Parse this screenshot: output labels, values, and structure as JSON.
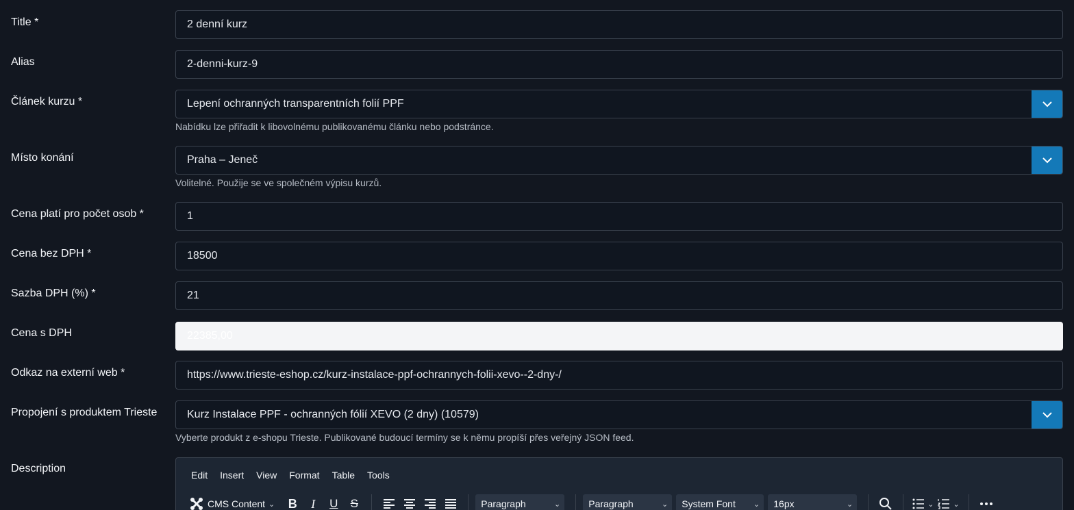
{
  "fields": {
    "title": {
      "label": "Title *",
      "value": "2 denní kurz"
    },
    "alias": {
      "label": "Alias",
      "value": "2-denni-kurz-9"
    },
    "clanek": {
      "label": "Článek kurzu *",
      "value": "Lepení ochranných transparentních folií PPF",
      "help": "Nabídku lze přiřadit k libovolnému publikovanému článku nebo podstránce."
    },
    "misto": {
      "label": "Místo konání",
      "value": "Praha – Jeneč",
      "help": "Volitelné. Použije se ve společném výpisu kurzů."
    },
    "osoby": {
      "label": "Cena platí pro počet osob *",
      "value": "1"
    },
    "cena_bez": {
      "label": "Cena bez DPH *",
      "value": "18500"
    },
    "sazba": {
      "label": "Sazba DPH (%) *",
      "value": "21"
    },
    "cena_s": {
      "label": "Cena s DPH",
      "value": "22385,00"
    },
    "odkaz": {
      "label": "Odkaz na externí web *",
      "value": "https://www.trieste-eshop.cz/kurz-instalace-ppf-ochrannych-folii-xevo--2-dny-/"
    },
    "produkt": {
      "label": "Propojení s produktem Trieste",
      "value": "Kurz Instalace PPF - ochranných fólií XEVO (2 dny) (10579)",
      "help": "Vyberte produkt z e-shopu Trieste. Publikované budoucí termíny se k němu propíší přes veřejný JSON feed."
    },
    "description": {
      "label": "Description"
    }
  },
  "editor": {
    "menu": [
      "Edit",
      "Insert",
      "View",
      "Format",
      "Table",
      "Tools"
    ],
    "cms_content": "CMS Content",
    "block_format": "Paragraph",
    "paragraph_style": "Paragraph",
    "font_family": "System Font",
    "font_size": "16px"
  },
  "colors": {
    "background": "#121720",
    "accent": "#1479b8",
    "border": "#3a424e"
  }
}
